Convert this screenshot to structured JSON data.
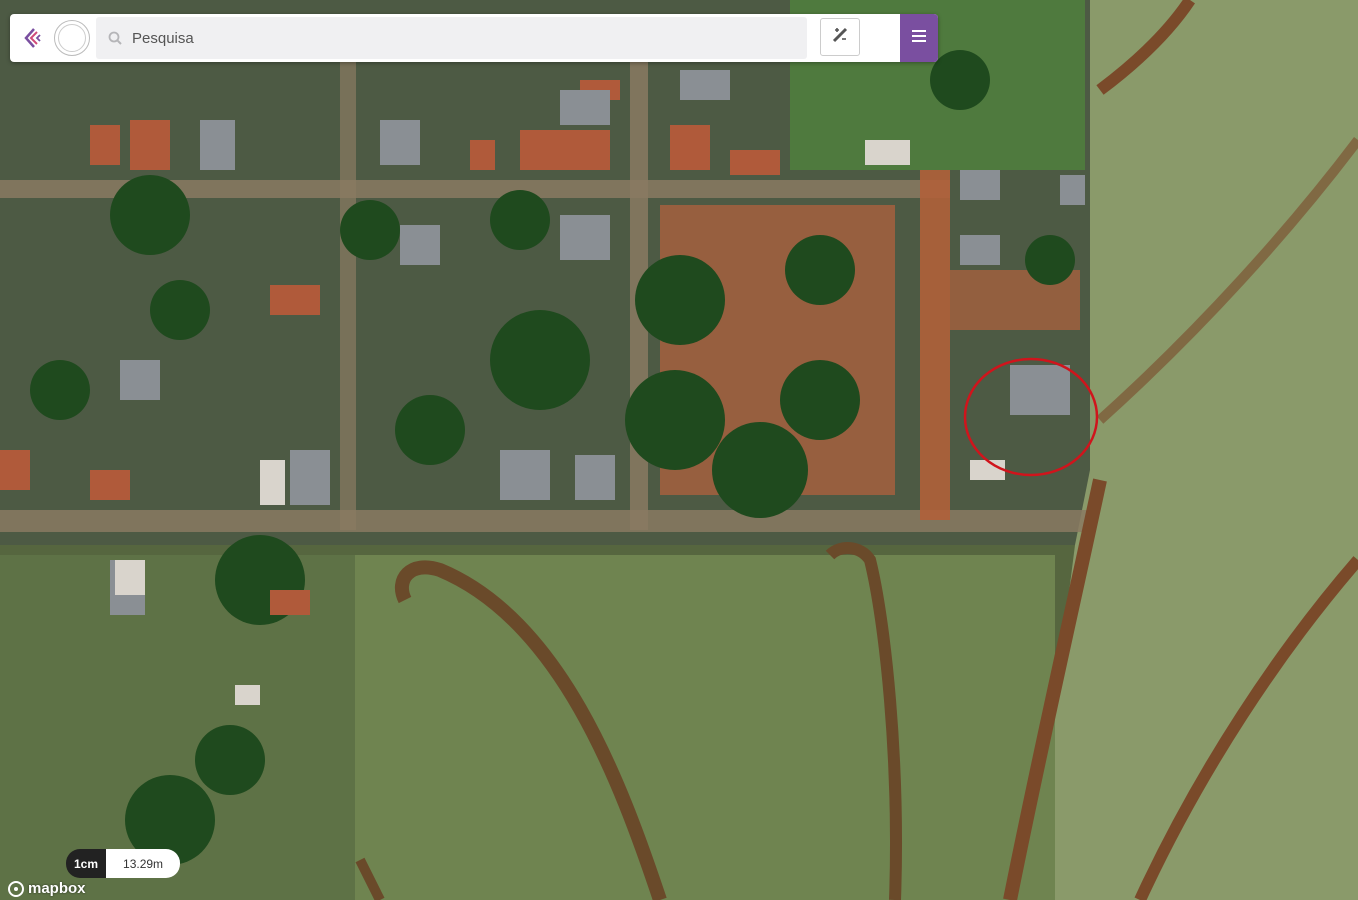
{
  "search": {
    "placeholder": "Pesquisa",
    "value": ""
  },
  "scale": {
    "unit": "1cm",
    "value": "13.29m"
  },
  "attribution": {
    "text": "mapbox"
  },
  "icons": {
    "logo": "brand-logo-icon",
    "seal": "municipal-seal-icon",
    "search": "search-icon",
    "tool": "measure-tool-icon",
    "menu": "hamburger-menu-icon"
  },
  "colors": {
    "accent": "#7a4fa0",
    "highlight": "#d0141c"
  }
}
